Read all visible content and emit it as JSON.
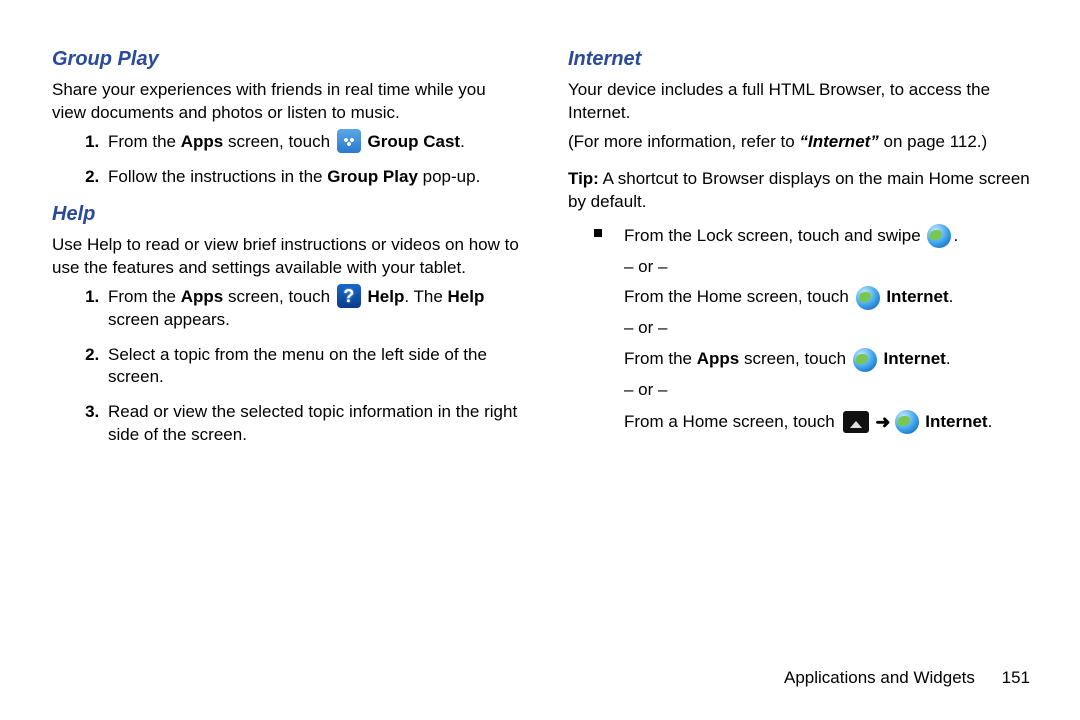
{
  "footer": {
    "section": "Applications and Widgets",
    "page": "151"
  },
  "left": {
    "group_play": {
      "title": "Group Play",
      "intro": "Share your experiences with friends in real time while you view documents and photos or listen to music.",
      "step1_a": "From the ",
      "step1_b": "Apps",
      "step1_c": " screen, touch ",
      "step1_d": "Group Cast",
      "step1_e": ".",
      "step2_a": "Follow the instructions in the ",
      "step2_b": "Group Play",
      "step2_c": " pop-up."
    },
    "help": {
      "title": "Help",
      "intro": "Use Help to read or view brief instructions or videos on how to use the features and settings available with your tablet.",
      "s1_a": "From the ",
      "s1_b": "Apps",
      "s1_c": " screen, touch ",
      "s1_d": "Help",
      "s1_e": ". The ",
      "s1_f": "Help",
      "s1_g": " screen appears.",
      "s2": "Select a topic from the menu on the left side of the screen.",
      "s3": "Read or view the selected topic information in the right side of the screen."
    }
  },
  "right": {
    "title": "Internet",
    "intro": "Your device includes a full HTML Browser, to access the Internet.",
    "xref_a": "(For more information, refer to ",
    "xref_b": "“Internet”",
    "xref_c": " on page 112.)",
    "tip_label": "Tip:",
    "tip_body": " A shortcut to Browser displays on the main Home screen by default.",
    "li1": "From the Lock screen, touch and swipe ",
    "li1_end": ".",
    "or": "– or –",
    "li2_a": "From the Home screen, touch ",
    "li2_b": "Internet",
    "li2_c": ".",
    "li3_a": "From the ",
    "li3_b": "Apps",
    "li3_c": " screen, touch ",
    "li3_d": "Internet",
    "li3_e": ".",
    "li4_a": "From a Home screen, touch ",
    "li4_arrow": "➜",
    "li4_b": "Internet",
    "li4_c": "."
  }
}
